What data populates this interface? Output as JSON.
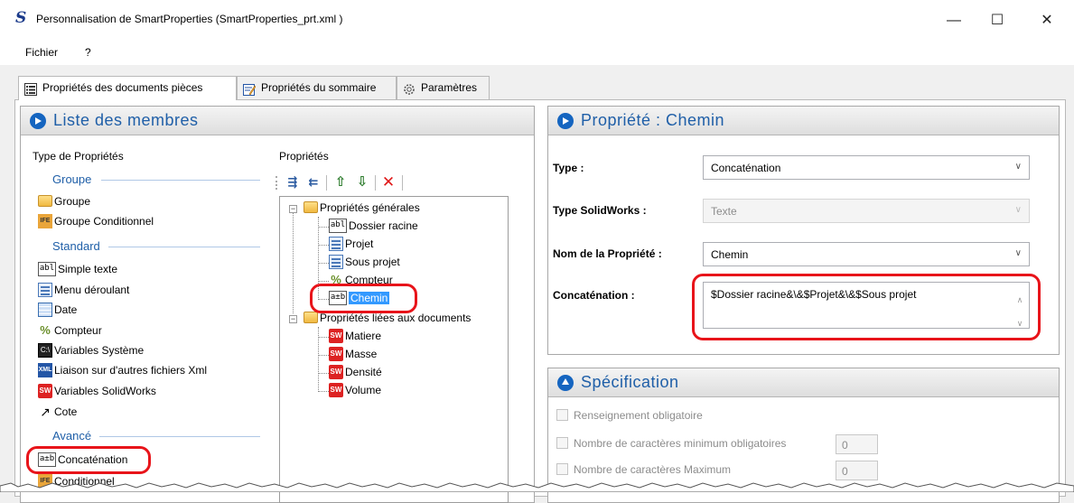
{
  "window": {
    "title": "Personnalisation de SmartProperties (SmartProperties_prt.xml )",
    "app_icon_glyph": "S",
    "controls": {
      "minimize": "—",
      "maximize": "☐",
      "close": "✕"
    }
  },
  "menu": {
    "items": [
      "Fichier",
      "?"
    ]
  },
  "tabs": [
    {
      "label": "Propriétés des documents pièces",
      "icon": "list-icon",
      "active": true
    },
    {
      "label": "Propriétés du sommaire",
      "icon": "edit-icon",
      "active": false
    },
    {
      "label": "Paramètres",
      "icon": "gear-icon",
      "active": false
    }
  ],
  "left_panel": {
    "title": "Liste des membres",
    "type_column_title": "Type de Propriétés",
    "props_column_title": "Propriétés",
    "groups": [
      {
        "name": "Groupe",
        "items": [
          {
            "label": "Groupe",
            "icon": "folder-icon"
          },
          {
            "label": "Groupe Conditionnel",
            "icon": "conditional-icon",
            "icon_text": "IFE"
          }
        ]
      },
      {
        "name": "Standard",
        "items": [
          {
            "label": "Simple texte",
            "icon": "text-field-icon",
            "icon_text": "abl"
          },
          {
            "label": "Menu déroulant",
            "icon": "dropdown-list-icon"
          },
          {
            "label": "Date",
            "icon": "calendar-icon"
          },
          {
            "label": "Compteur",
            "icon": "counter-icon",
            "icon_text": "%"
          },
          {
            "label": "Variables Système",
            "icon": "system-variables-icon",
            "icon_text": "C:\\"
          },
          {
            "label": "Liaison sur d'autres fichiers Xml",
            "icon": "xml-icon",
            "icon_text": "XML"
          },
          {
            "label": "Variables SolidWorks",
            "icon": "solidworks-icon",
            "icon_text": "SW"
          },
          {
            "label": "Cote",
            "icon": "dimension-icon",
            "icon_text": "↗"
          }
        ]
      },
      {
        "name": "Avancé",
        "items": [
          {
            "label": "Concaténation",
            "icon": "concatenation-icon",
            "icon_text": "a±b"
          },
          {
            "label": "Conditionnel",
            "icon": "conditional-icon",
            "icon_text": "IFE"
          }
        ]
      }
    ],
    "toolbar": {
      "expand_all": "⇶",
      "collapse_all": "⇇",
      "move_up": "⇧",
      "move_down": "⇩",
      "delete": "✕"
    },
    "tree": [
      {
        "label": "Propriétés générales",
        "icon": "folder-icon",
        "expanded": true,
        "children": [
          {
            "label": "Dossier racine",
            "icon": "text-field-icon",
            "icon_text": "abl"
          },
          {
            "label": "Projet",
            "icon": "dropdown-list-icon"
          },
          {
            "label": "Sous projet",
            "icon": "dropdown-list-icon"
          },
          {
            "label": "Compteur",
            "icon": "counter-icon",
            "icon_text": "%"
          },
          {
            "label": "Chemin",
            "icon": "concatenation-icon",
            "icon_text": "a±b",
            "selected": true
          }
        ]
      },
      {
        "label": "Propriétés liées aux documents",
        "icon": "folder-icon",
        "expanded": true,
        "children": [
          {
            "label": "Matiere",
            "icon": "solidworks-icon",
            "icon_text": "SW"
          },
          {
            "label": "Masse",
            "icon": "solidworks-icon",
            "icon_text": "SW"
          },
          {
            "label": "Densité",
            "icon": "solidworks-icon",
            "icon_text": "SW"
          },
          {
            "label": "Volume",
            "icon": "solidworks-icon",
            "icon_text": "SW"
          }
        ]
      }
    ]
  },
  "property_panel": {
    "title": "Propriété : Chemin",
    "type_label": "Type :",
    "type_value": "Concaténation",
    "sw_type_label": "Type SolidWorks :",
    "sw_type_value": "Texte",
    "name_label": "Nom de la Propriété :",
    "name_value": "Chemin",
    "concat_label": "Concaténation :",
    "concat_value": "$Dossier racine&\\&$Projet&\\&$Sous projet"
  },
  "spec_panel": {
    "title": "Spécification",
    "required_label": "Renseignement obligatoire",
    "min_chars_label": "Nombre de caractères minimum obligatoires",
    "min_chars_value": "0",
    "max_chars_label": "Nombre de caractères Maximum",
    "max_chars_value": "0"
  },
  "colors": {
    "accent": "#1f5fa8",
    "highlight": "#e8141a",
    "selection": "#3399ff"
  }
}
